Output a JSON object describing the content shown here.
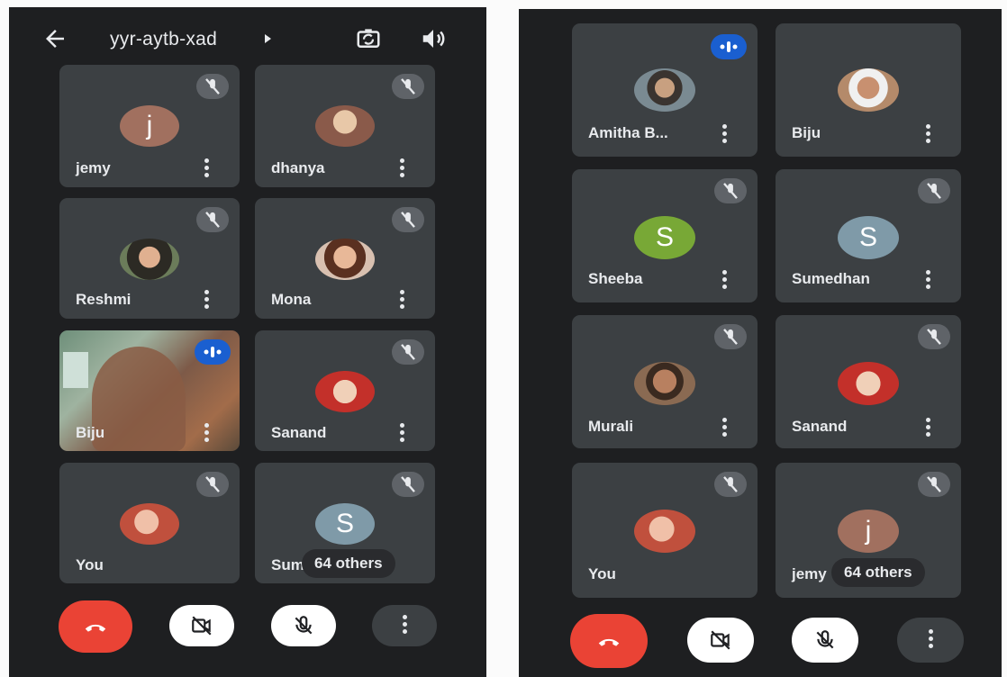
{
  "left_screen": {
    "meeting_code": "yyr-aytb-xad",
    "tiles": [
      {
        "name": "jemy",
        "avatar_letter": "j",
        "avatar_color": "#a1705f",
        "muted": true
      },
      {
        "name": "dhanya",
        "avatar_letter": "",
        "avatar_color": "#8a5a4a",
        "muted": true
      },
      {
        "name": "Reshmi",
        "avatar_letter": "",
        "avatar_color": "#6b7c5a",
        "muted": true
      },
      {
        "name": "Mona",
        "avatar_letter": "",
        "avatar_color": "#c99a86",
        "muted": true
      },
      {
        "name": "Biju",
        "avatar_letter": "",
        "avatar_color": "#9a6a4e",
        "muted": false,
        "speaking": true,
        "video": true
      },
      {
        "name": "Sanand",
        "avatar_letter": "",
        "avatar_color": "#c3302a",
        "muted": true
      },
      {
        "name": "You",
        "avatar_letter": "",
        "avatar_color": "#c0503d",
        "muted": true
      },
      {
        "name": "Sum",
        "avatar_letter": "S",
        "avatar_color": "#7f9aa8",
        "muted": true,
        "overlay": "64 others"
      }
    ]
  },
  "right_screen": {
    "tiles": [
      {
        "name": "Amitha B...",
        "avatar_letter": "",
        "avatar_color": "#7a8a92",
        "muted": false,
        "speaking": true
      },
      {
        "name": "Biju",
        "avatar_letter": "",
        "avatar_color": "#b48a6a",
        "muted": false
      },
      {
        "name": "Sheeba",
        "avatar_letter": "S",
        "avatar_color": "#78a836",
        "muted": true
      },
      {
        "name": "Sumedhan",
        "avatar_letter": "S",
        "avatar_color": "#7f9aa8",
        "muted": true
      },
      {
        "name": "Murali",
        "avatar_letter": "",
        "avatar_color": "#8a6a52",
        "muted": true
      },
      {
        "name": "Sanand",
        "avatar_letter": "",
        "avatar_color": "#c3302a",
        "muted": true
      },
      {
        "name": "You",
        "avatar_letter": "",
        "avatar_color": "#c0503d",
        "muted": true
      },
      {
        "name": "jemy",
        "avatar_letter": "j",
        "avatar_color": "#a1705f",
        "muted": true,
        "overlay": "64 others"
      }
    ]
  },
  "controls": [
    "hang-up",
    "camera-off",
    "mic-off",
    "more-options"
  ],
  "colors": {
    "background": "#1e1f21",
    "tile": "#3c4043",
    "hangup": "#ea4335",
    "speaking": "#1a5fd0",
    "badge": "#5f6368"
  }
}
